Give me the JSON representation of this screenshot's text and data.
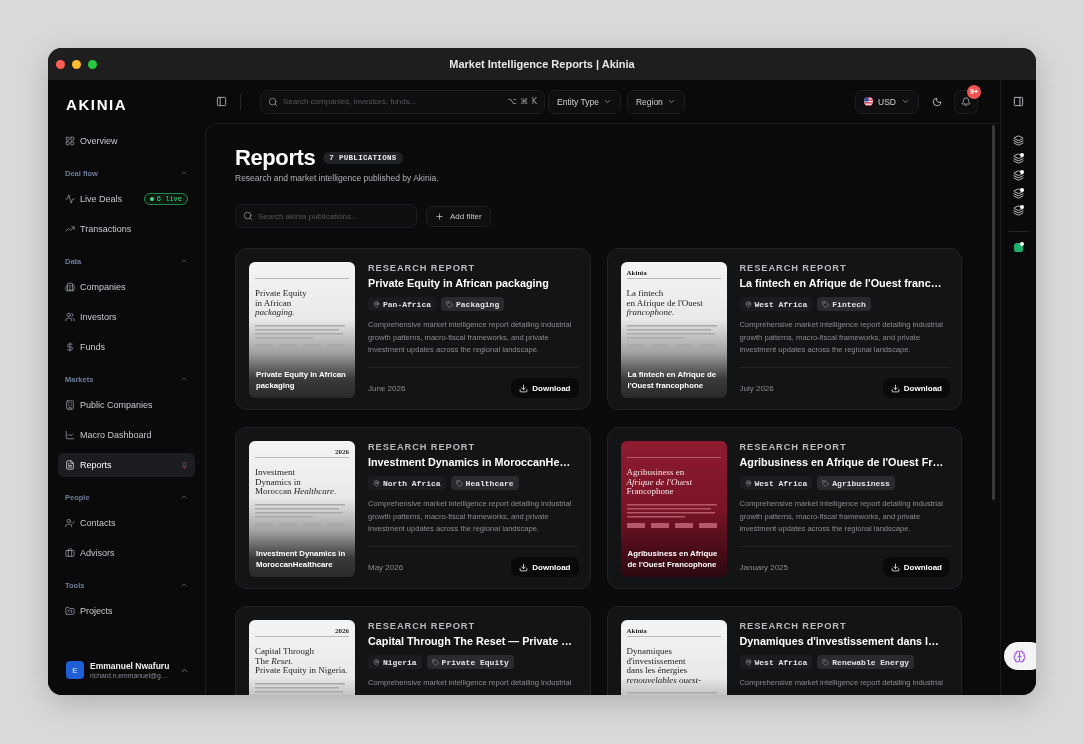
{
  "window": {
    "title": "Market Intelligence Reports | Akinia"
  },
  "sidebar": {
    "logo": "AKINIA",
    "items": [
      {
        "label": "Overview",
        "selected": false,
        "pinned": false
      }
    ],
    "sections": [
      {
        "title": "Deal flow",
        "expanded": true,
        "items": [
          {
            "label": "Live Deals",
            "selected": false,
            "pinned": false,
            "badge": "6 live"
          },
          {
            "label": "Transactions",
            "selected": false,
            "pinned": false
          }
        ]
      },
      {
        "title": "Data",
        "expanded": true,
        "items": [
          {
            "label": "Companies",
            "selected": false,
            "pinned": false
          },
          {
            "label": "Investors",
            "selected": false,
            "pinned": false
          },
          {
            "label": "Funds",
            "selected": false,
            "pinned": false
          }
        ]
      },
      {
        "title": "Markets",
        "expanded": true,
        "items": [
          {
            "label": "Public Companies",
            "selected": false,
            "pinned": false
          },
          {
            "label": "Macro Dashboard",
            "selected": false,
            "pinned": false
          },
          {
            "label": "Reports",
            "selected": true,
            "pinned": true
          }
        ]
      },
      {
        "title": "People",
        "expanded": true,
        "items": [
          {
            "label": "Contacts",
            "selected": false,
            "pinned": false
          },
          {
            "label": "Advisors",
            "selected": false,
            "pinned": false
          }
        ]
      },
      {
        "title": "Tools",
        "expanded": true,
        "items": [
          {
            "label": "Projects",
            "selected": false,
            "pinned": false
          }
        ]
      }
    ],
    "user": {
      "initial": "E",
      "name": "Emmanuel Nwafuru",
      "email": "richard.n.emmanuel@g…"
    }
  },
  "topbar": {
    "search": {
      "placeholder": "Search companies, investors, funds...",
      "shortcut": "⌥ ⌘ K"
    },
    "filters": [
      "Entity Type",
      "Region"
    ],
    "currency": "USD",
    "notification_count": "9+"
  },
  "page": {
    "title": "Reports",
    "count": "7 PUBLICATIONS",
    "subtitle": "Research and market intelligence published by Akinia.",
    "search": {
      "placeholder": "Search akinia publications..."
    },
    "add_filter": "Add filter"
  },
  "reports": [
    {
      "category": "RESEARCH REPORT",
      "title": "Private Equity in African packaging",
      "tags": [
        {
          "kind": "location",
          "label": "Pan-Africa"
        },
        {
          "kind": "sector",
          "label": "Packaging"
        }
      ],
      "description": "Comprehensive market intelligence report detailing industrial growth patterns, macro-fiscal frameworks, and private investment updates across the regional landscape.",
      "date": "June 2026",
      "download": "Download",
      "cover": {
        "kind": "paper",
        "heading": "Private Equity\nin African\n*packaging.*",
        "caption": "Private Equity in African packaging"
      }
    },
    {
      "category": "RESEARCH REPORT",
      "title": "La fintech en Afrique de l'Ouest franc…",
      "tags": [
        {
          "kind": "location",
          "label": "West Africa"
        },
        {
          "kind": "sector",
          "label": "Fintech"
        }
      ],
      "description": "Comprehensive market intelligence report detailing industrial growth patterns, macro-fiscal frameworks, and private investment updates across the regional landscape.",
      "date": "July 2026",
      "download": "Download",
      "cover": {
        "kind": "paper",
        "brand": "Akinia",
        "heading": "La fintech\nen Afrique de l'Ouest\n*francophone.*",
        "caption": "La fintech en Afrique de l'Ouest francophone"
      }
    },
    {
      "category": "RESEARCH REPORT",
      "title": "Investment Dynamics in MoroccanHe…",
      "tags": [
        {
          "kind": "location",
          "label": "North Africa"
        },
        {
          "kind": "sector",
          "label": "Healthcare"
        }
      ],
      "description": "Comprehensive market intelligence report detailing industrial growth patterns, macro-fiscal frameworks, and private investment updates across the regional landscape.",
      "date": "May 2026",
      "download": "Download",
      "cover": {
        "kind": "paper",
        "year": "2026",
        "heading": "Investment\nDynamics in\nMoroccan *Healthcare.*",
        "caption": "Investment Dynamics in MoroccanHealthcare"
      }
    },
    {
      "category": "RESEARCH REPORT",
      "title": "Agribusiness en Afrique de l'Ouest Fr…",
      "tags": [
        {
          "kind": "location",
          "label": "West Africa"
        },
        {
          "kind": "sector",
          "label": "Agribusiness"
        }
      ],
      "description": "Comprehensive market intelligence report detailing industrial growth patterns, macro-fiscal frameworks, and private investment updates across the regional landscape.",
      "date": "January 2025",
      "download": "Download",
      "cover": {
        "kind": "crimson",
        "heading": "Agribusiness en\n*Afrique de l'Ouest*\nFrancophone",
        "caption": "Agribusiness en Afrique de l'Ouest Francophone"
      }
    },
    {
      "category": "RESEARCH REPORT",
      "title": "Capital Through The Reset — Private …",
      "tags": [
        {
          "kind": "location",
          "label": "Nigeria"
        },
        {
          "kind": "sector",
          "label": "Private Equity"
        }
      ],
      "description": "Comprehensive market intelligence report detailing industrial",
      "cover": {
        "kind": "paper",
        "year": "2026",
        "heading": "Capital Through\nThe *Reset.*\nPrivate Equity in Nigeria."
      }
    },
    {
      "category": "RESEARCH REPORT",
      "title": "Dynamiques d'investissement dans l…",
      "tags": [
        {
          "kind": "location",
          "label": "West Africa"
        },
        {
          "kind": "sector",
          "label": "Renewable Energy"
        }
      ],
      "description": "Comprehensive market intelligence report detailing industrial",
      "cover": {
        "kind": "paper",
        "brand": "Akinia",
        "heading": "Dynamiques\nd'investissement\ndans les énergies\n*renouvelables ouest-*"
      }
    }
  ],
  "right_rail": {
    "items": [
      {
        "kind": "layers",
        "dot": false
      },
      {
        "kind": "layers",
        "dot": true
      },
      {
        "kind": "layers",
        "dot": true
      },
      {
        "kind": "layers",
        "dot": true
      },
      {
        "kind": "layers",
        "dot": true
      },
      {
        "kind": "tile",
        "dot": true
      }
    ]
  }
}
